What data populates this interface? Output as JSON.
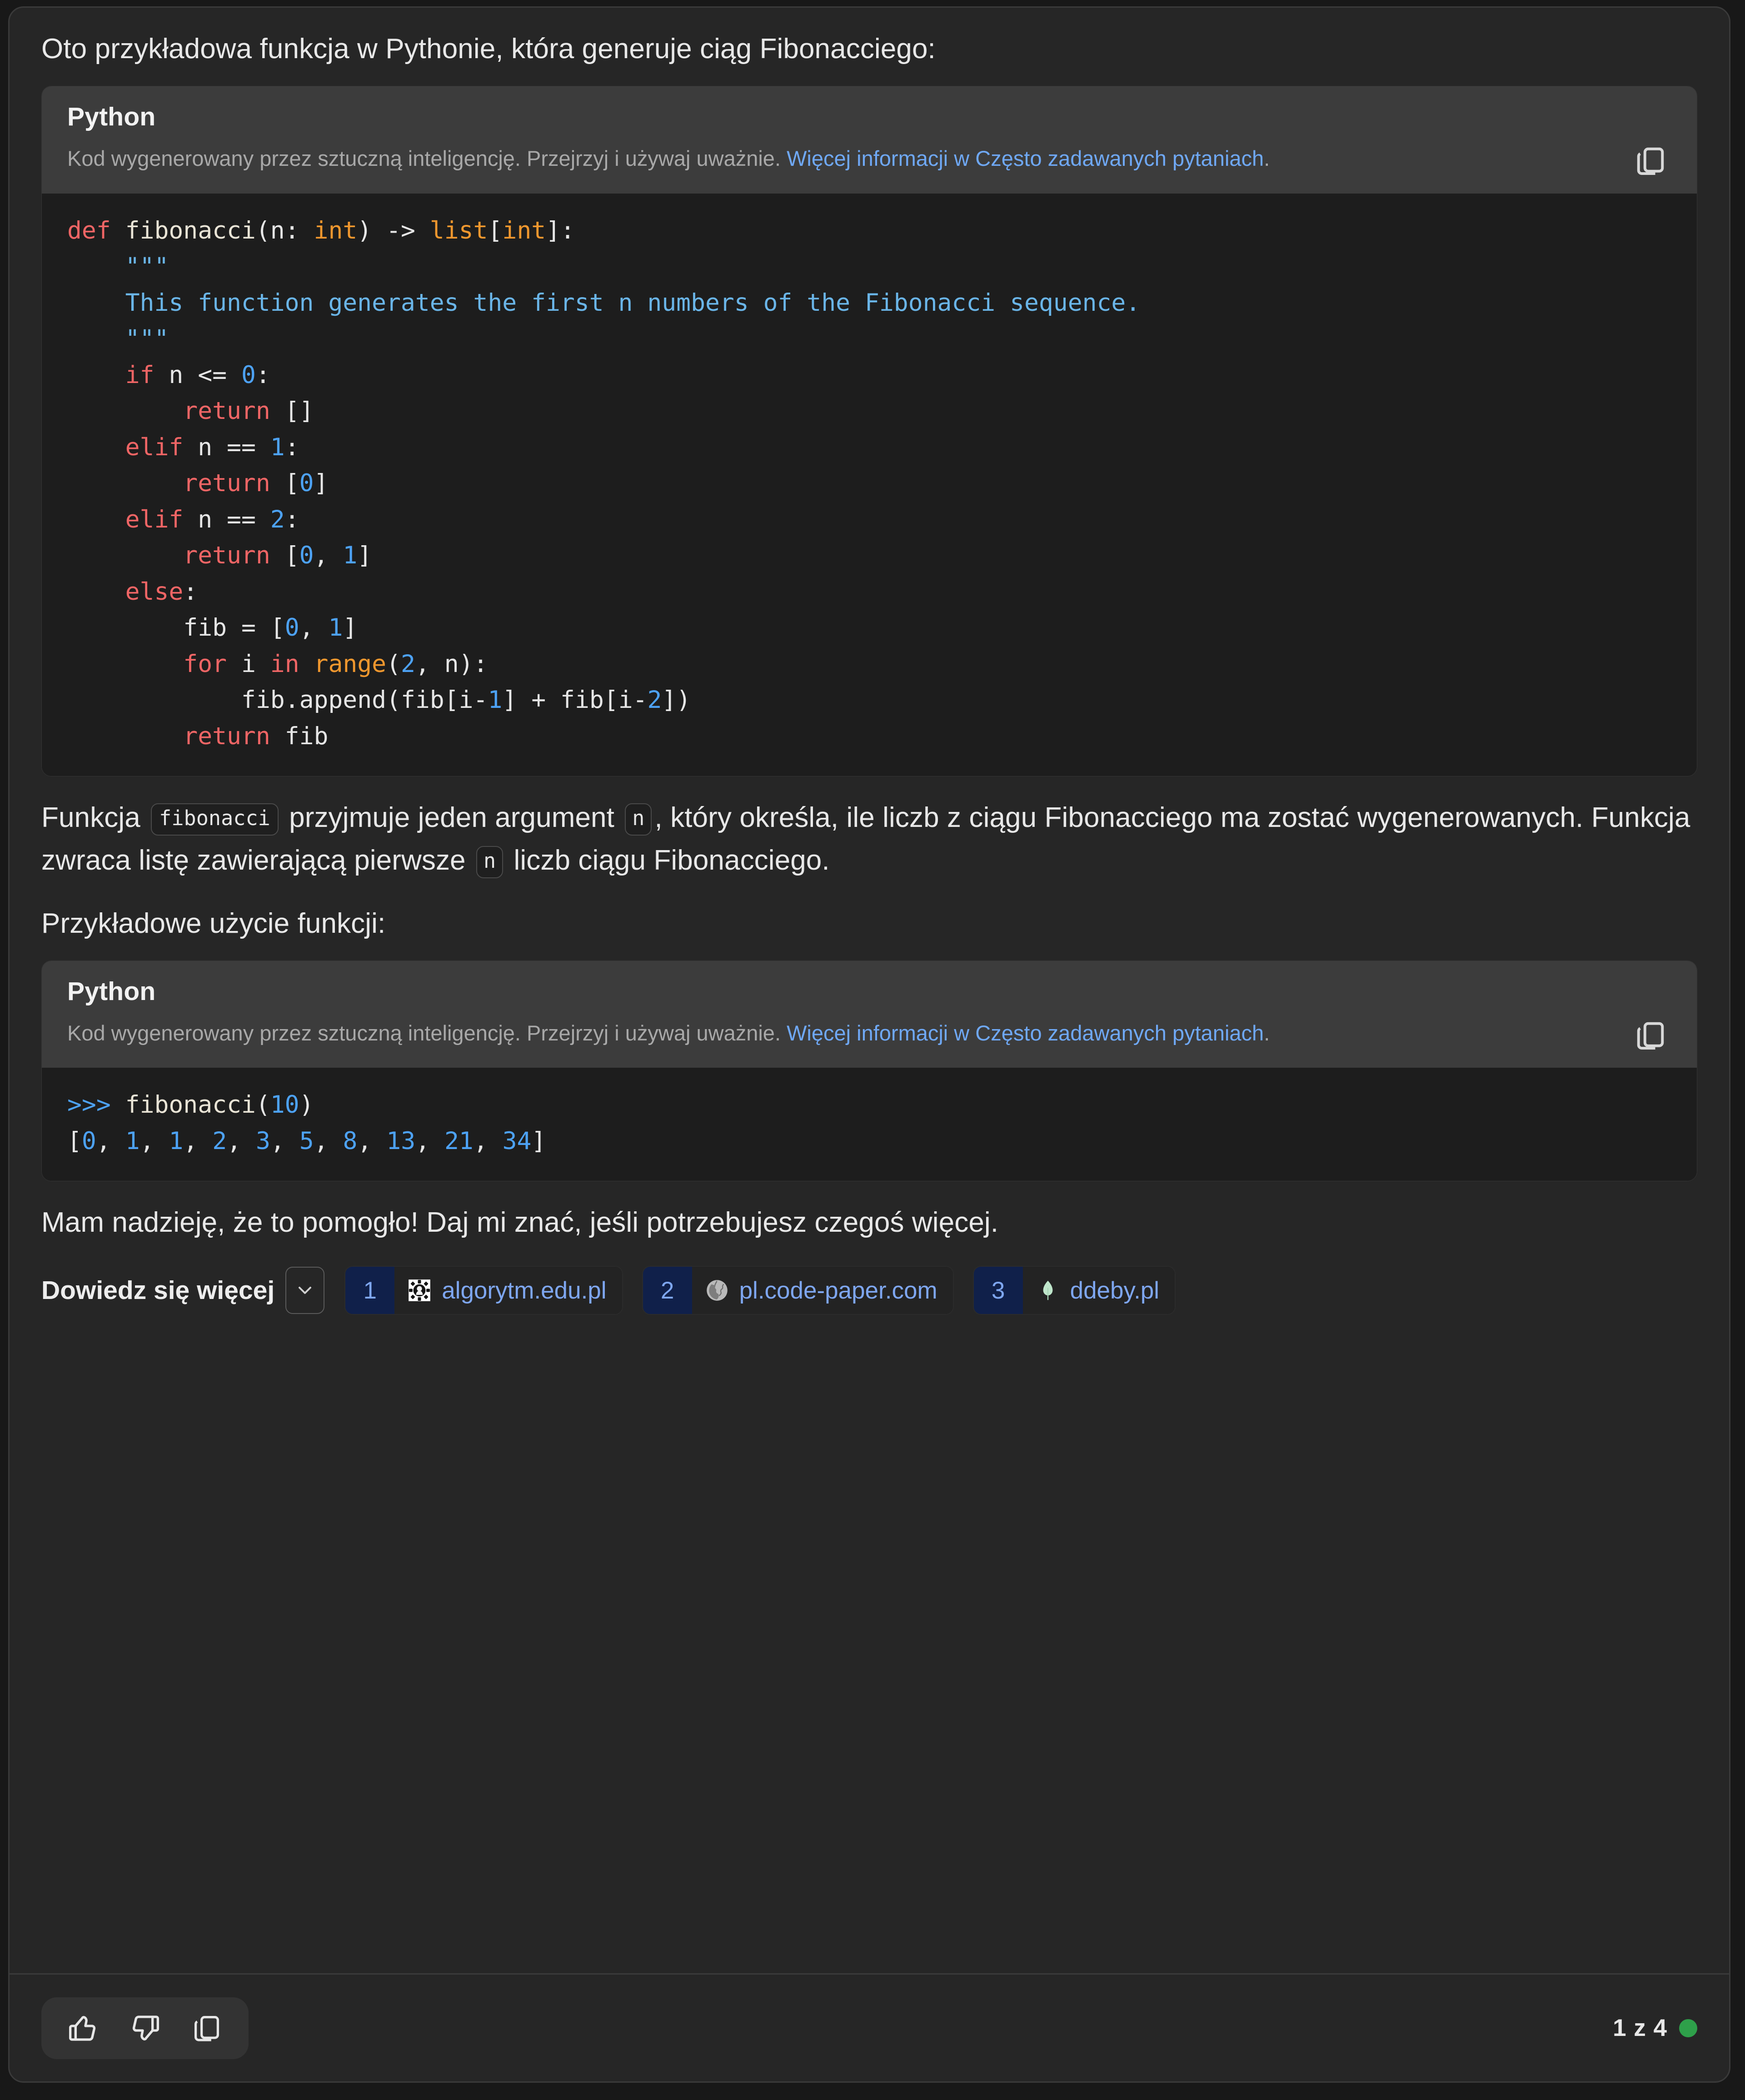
{
  "intro": {
    "text": "Oto przykładowa funkcja w Pythonie, która generuje ciąg Fibonacciego:"
  },
  "code_block_1": {
    "language": "Python",
    "disclaimer_text": "Kod wygenerowany przez sztuczną inteligencję. Przejrzyj i używaj uważnie. ",
    "disclaimer_link": "Więcej informacji w Często zadawanych pytaniach",
    "disclaimer_period": ".",
    "copy_icon": "copy-icon",
    "code_lines": [
      "def fibonacci(n: int) -> list[int]:",
      "    \"\"\"",
      "    This function generates the first n numbers of the Fibonacci sequence.",
      "    \"\"\"",
      "    if n <= 0:",
      "        return []",
      "    elif n == 1:",
      "        return [0]",
      "    elif n == 2:",
      "        return [0, 1]",
      "    else:",
      "        fib = [0, 1]",
      "        for i in range(2, n):",
      "            fib.append(fib[i-1] + fib[i-2])",
      "        return fib"
    ]
  },
  "paragraph_1": {
    "part_a": "Funkcja ",
    "code_a": "fibonacci",
    "part_b": " przyjmuje jeden argument ",
    "code_b": "n",
    "part_c": ", który określa, ile liczb z ciągu Fibonacciego ma zostać wygenerowanych. Funkcja zwraca listę zawierającą pierwsze ",
    "code_c": "n",
    "part_d": " liczb ciągu Fibonacciego."
  },
  "paragraph_2": {
    "text": "Przykładowe użycie funkcji:"
  },
  "code_block_2": {
    "language": "Python",
    "disclaimer_text": "Kod wygenerowany przez sztuczną inteligencję. Przejrzyj i używaj uważnie. ",
    "disclaimer_link": "Więcej informacji w Często zadawanych pytaniach",
    "disclaimer_period": ".",
    "copy_icon": "copy-icon",
    "code_lines": [
      ">>> fibonacci(10)",
      "[0, 1, 1, 2, 3, 5, 8, 13, 21, 34]"
    ]
  },
  "closing": {
    "text": "Mam nadzieję, że to pomogło! Daj mi znać, jeśli potrzebujesz czegoś więcej."
  },
  "sources": {
    "learn_more_label": "Dowiedz się więcej",
    "chevron_icon": "chevron-down-icon",
    "citations": [
      {
        "number": "1",
        "label": "algorytm.edu.pl",
        "favicon": "gear-favicon-icon"
      },
      {
        "number": "2",
        "label": "pl.code-paper.com",
        "favicon": "globe-favicon-icon"
      },
      {
        "number": "3",
        "label": "ddeby.pl",
        "favicon": "leaf-favicon-icon"
      }
    ]
  },
  "footer": {
    "thumbs_up_icon": "thumbs-up-icon",
    "thumbs_down_icon": "thumbs-down-icon",
    "copy_icon": "copy-icon",
    "page_indicator": "1 z 4",
    "status_dot_color": "#2ea04a"
  },
  "colors": {
    "page_bg": "#181818",
    "card_bg": "#262626",
    "code_head_bg": "#3c3c3c",
    "code_body_bg": "#1d1d1d",
    "link_blue": "#6fa8f5",
    "citation_number_bg": "#10204a",
    "keyword_red": "#ef6565",
    "builtin_orange": "#f0972e",
    "number_blue": "#4da2f5",
    "string_blue": "#6ab5e8"
  }
}
